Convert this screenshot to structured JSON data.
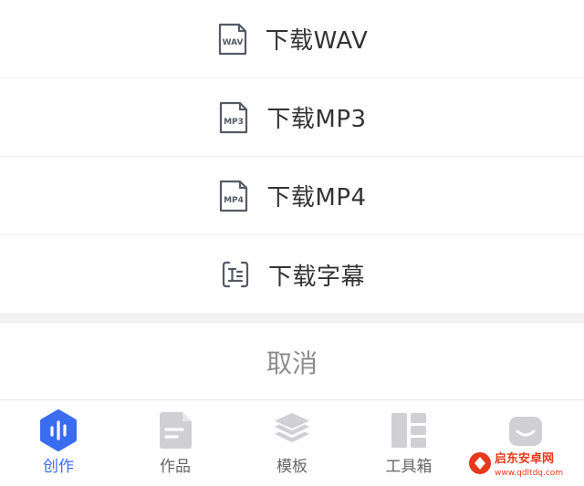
{
  "action_sheet": {
    "options": [
      {
        "label": "下载WAV",
        "icon": "wav-file-icon",
        "badge": "WAV"
      },
      {
        "label": "下载MP3",
        "icon": "mp3-file-icon",
        "badge": "MP3"
      },
      {
        "label": "下载MP4",
        "icon": "mp4-file-icon",
        "badge": "MP4"
      },
      {
        "label": "下载字幕",
        "icon": "subtitle-icon"
      }
    ],
    "cancel_label": "取消"
  },
  "tabbar": {
    "tabs": [
      {
        "label": "创作",
        "icon": "create-icon",
        "active": true
      },
      {
        "label": "作品",
        "icon": "works-icon",
        "active": false
      },
      {
        "label": "模板",
        "icon": "template-icon",
        "active": false
      },
      {
        "label": "工具箱",
        "icon": "toolbox-icon",
        "active": false
      },
      {
        "label": "",
        "icon": "profile-icon",
        "active": false
      }
    ]
  },
  "watermark": {
    "text": "启东安卓网",
    "url_text": "www.qdltdq.com"
  },
  "colors": {
    "accent": "#3a6cf0",
    "icon_gray": "#cfcfd4",
    "text": "#333333",
    "cancel_text": "#8c8c8c"
  }
}
